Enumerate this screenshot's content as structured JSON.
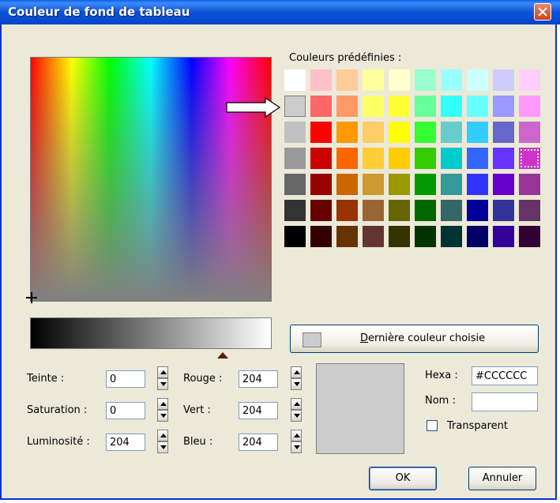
{
  "window": {
    "title": "Couleur de fond de tableau"
  },
  "presets": {
    "label": "Couleurs prédéfinies :",
    "rows": [
      [
        "#ffffff",
        "#ffc0c8",
        "#ffcc99",
        "#ffff99",
        "#ffffcc",
        "#99ffcc",
        "#99ffff",
        "#ccffff",
        "#ccccff",
        "#ffccff"
      ],
      [
        "#cccccc",
        "#ff6666",
        "#ff9966",
        "#ffff66",
        "#ffff33",
        "#66ff99",
        "#33ffff",
        "#66ffff",
        "#9999ff",
        "#ff99ff"
      ],
      [
        "#c0c0c0",
        "#ff0000",
        "#ff9900",
        "#ffcc66",
        "#ffff00",
        "#33ff33",
        "#66cccc",
        "#33ccff",
        "#6666cc",
        "#cc66cc"
      ],
      [
        "#999999",
        "#cc0000",
        "#ff6600",
        "#ffcc33",
        "#ffcc00",
        "#33cc00",
        "#00cccc",
        "#3366ff",
        "#6633ff",
        "#cc33cc"
      ],
      [
        "#666666",
        "#990000",
        "#cc6600",
        "#cc9933",
        "#999900",
        "#009900",
        "#339999",
        "#3333ff",
        "#6600cc",
        "#993399"
      ],
      [
        "#333333",
        "#660000",
        "#993300",
        "#996633",
        "#666600",
        "#006600",
        "#336666",
        "#000099",
        "#333399",
        "#663366"
      ],
      [
        "#000000",
        "#330000",
        "#663300",
        "#663333",
        "#333300",
        "#003300",
        "#003333",
        "#000066",
        "#330099",
        "#330033"
      ]
    ],
    "selected_row": 3,
    "selected_col": 9
  },
  "last_color": {
    "label_prefix": "",
    "label_underlined": "D",
    "label_rest": "ernière couleur choisie",
    "color": "#cccccc"
  },
  "fields": {
    "teinte_label": "Teinte :",
    "teinte_value": "0",
    "saturation_label": "Saturation :",
    "saturation_value": "0",
    "luminosite_label": "Luminosité :",
    "luminosite_value": "204",
    "rouge_label": "Rouge :",
    "rouge_value": "204",
    "vert_label": "Vert :",
    "vert_value": "204",
    "bleu_label": "Bleu :",
    "bleu_value": "204",
    "hexa_label": "Hexa :",
    "hexa_value": "#CCCCCC",
    "nom_label": "Nom :",
    "nom_value": "",
    "transparent_label": "Transparent"
  },
  "current_color": "#cccccc",
  "buttons": {
    "ok": "OK",
    "cancel": "Annuler"
  }
}
